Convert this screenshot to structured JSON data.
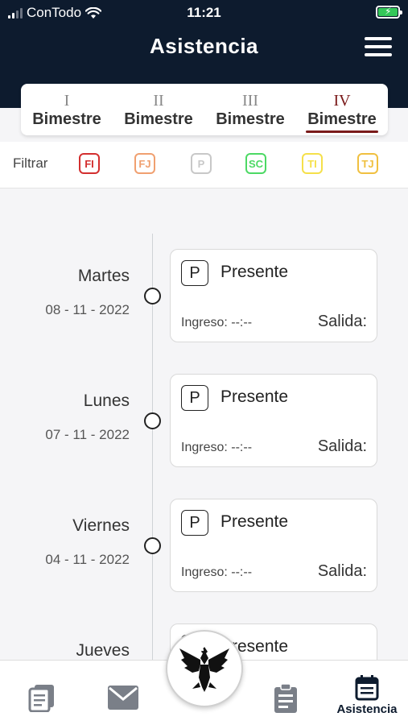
{
  "status_bar": {
    "carrier": "ConTodo",
    "time": "11:21"
  },
  "header": {
    "title": "Asistencia"
  },
  "tabs": [
    {
      "roman": "I",
      "label": "Bimestre",
      "active": false
    },
    {
      "roman": "II",
      "label": "Bimestre",
      "active": false
    },
    {
      "roman": "III",
      "label": "Bimestre",
      "active": false
    },
    {
      "roman": "IV",
      "label": "Bimestre",
      "active": true
    }
  ],
  "filter": {
    "label": "Filtrar",
    "chips": [
      {
        "code": "FI",
        "color": "#d32f2f"
      },
      {
        "code": "FJ",
        "color": "#f0a070"
      },
      {
        "code": "P",
        "color": "#c8c8c8"
      },
      {
        "code": "SC",
        "color": "#4cd964"
      },
      {
        "code": "TI",
        "color": "#f5e04a"
      },
      {
        "code": "TJ",
        "color": "#f0c040"
      }
    ]
  },
  "records": [
    {
      "day": "Martes",
      "date": "08 - 11 - 2022",
      "badge": "P",
      "status": "Presente",
      "ingreso": "Ingreso: --:--",
      "salida": "Salida:"
    },
    {
      "day": "Lunes",
      "date": "07 - 11 - 2022",
      "badge": "P",
      "status": "Presente",
      "ingreso": "Ingreso: --:--",
      "salida": "Salida:"
    },
    {
      "day": "Viernes",
      "date": "04 - 11 - 2022",
      "badge": "P",
      "status": "Presente",
      "ingreso": "Ingreso: --:--",
      "salida": "Salida:"
    },
    {
      "day": "Jueves",
      "date": "",
      "badge": "P",
      "status": "Presente",
      "ingreso": "",
      "salida": ""
    }
  ],
  "bottom_nav": {
    "items": [
      {
        "icon": "documents-icon",
        "label": ""
      },
      {
        "icon": "mail-icon",
        "label": ""
      },
      {
        "icon": "clipboard-icon",
        "label": ""
      },
      {
        "icon": "calendar-icon",
        "label": "Asistencia"
      }
    ],
    "logo": "eagle-logo"
  },
  "colors": {
    "header_bg": "#0d1b2e",
    "accent": "#7a1a1a"
  }
}
